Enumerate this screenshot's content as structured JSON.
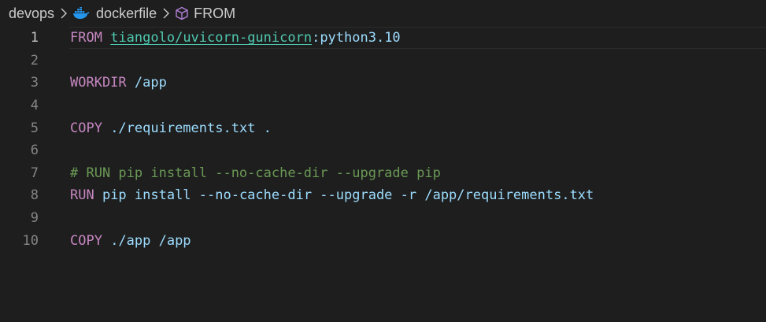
{
  "breadcrumb": {
    "folder": "devops",
    "file": "dockerfile",
    "symbol": "FROM",
    "file_icon": "docker-whale-icon",
    "symbol_icon": "cube-symbol-icon"
  },
  "editor": {
    "active_line": 1,
    "lines": [
      {
        "number": "1",
        "segments": [
          {
            "text": "FROM",
            "kind": "keyword"
          },
          {
            "text": " ",
            "kind": "plain"
          },
          {
            "text": "tiangolo/uvicorn-gunicorn",
            "kind": "link"
          },
          {
            "text": ":python3.10",
            "kind": "text"
          }
        ]
      },
      {
        "number": "2",
        "segments": []
      },
      {
        "number": "3",
        "segments": [
          {
            "text": "WORKDIR",
            "kind": "keyword"
          },
          {
            "text": " /app",
            "kind": "text"
          }
        ]
      },
      {
        "number": "4",
        "segments": []
      },
      {
        "number": "5",
        "segments": [
          {
            "text": "COPY",
            "kind": "keyword"
          },
          {
            "text": " ./requirements.txt .",
            "kind": "text"
          }
        ]
      },
      {
        "number": "6",
        "segments": []
      },
      {
        "number": "7",
        "segments": [
          {
            "text": "# RUN pip install --no-cache-dir --upgrade pip",
            "kind": "comment"
          }
        ]
      },
      {
        "number": "8",
        "segments": [
          {
            "text": "RUN",
            "kind": "keyword"
          },
          {
            "text": " pip install --no-cache-dir --upgrade -r /app/requirements.txt",
            "kind": "text"
          }
        ]
      },
      {
        "number": "9",
        "segments": []
      },
      {
        "number": "10",
        "segments": [
          {
            "text": "COPY",
            "kind": "keyword"
          },
          {
            "text": " ./app /app",
            "kind": "text"
          }
        ]
      }
    ]
  },
  "colors": {
    "background": "#1e1e1e",
    "keyword": "#c586c0",
    "text": "#9cdcfe",
    "comment": "#6a9955",
    "link": "#4ec9b0",
    "line_number": "#858585",
    "active_line_number": "#c6c6c6"
  }
}
